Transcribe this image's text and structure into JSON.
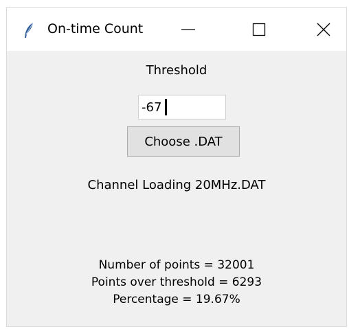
{
  "window": {
    "title": "On-time Count",
    "icons": {
      "app": "feather-icon",
      "minimize": "minimize-icon",
      "maximize": "maximize-icon",
      "close": "close-icon"
    }
  },
  "form": {
    "threshold_label": "Threshold",
    "threshold_value": "-67",
    "choose_button_label": "Choose .DAT",
    "file_label": "Channel Loading 20MHz.DAT"
  },
  "stats": {
    "points": "Number of points = 32001",
    "over_threshold": "Points over threshold = 6293",
    "percentage": "Percentage = 19.67%"
  },
  "colors": {
    "window_bg": "#f0f0f0",
    "titlebar_bg": "#ffffff",
    "button_bg": "#e1e1e1",
    "app_icon": "#3b6fb0"
  }
}
